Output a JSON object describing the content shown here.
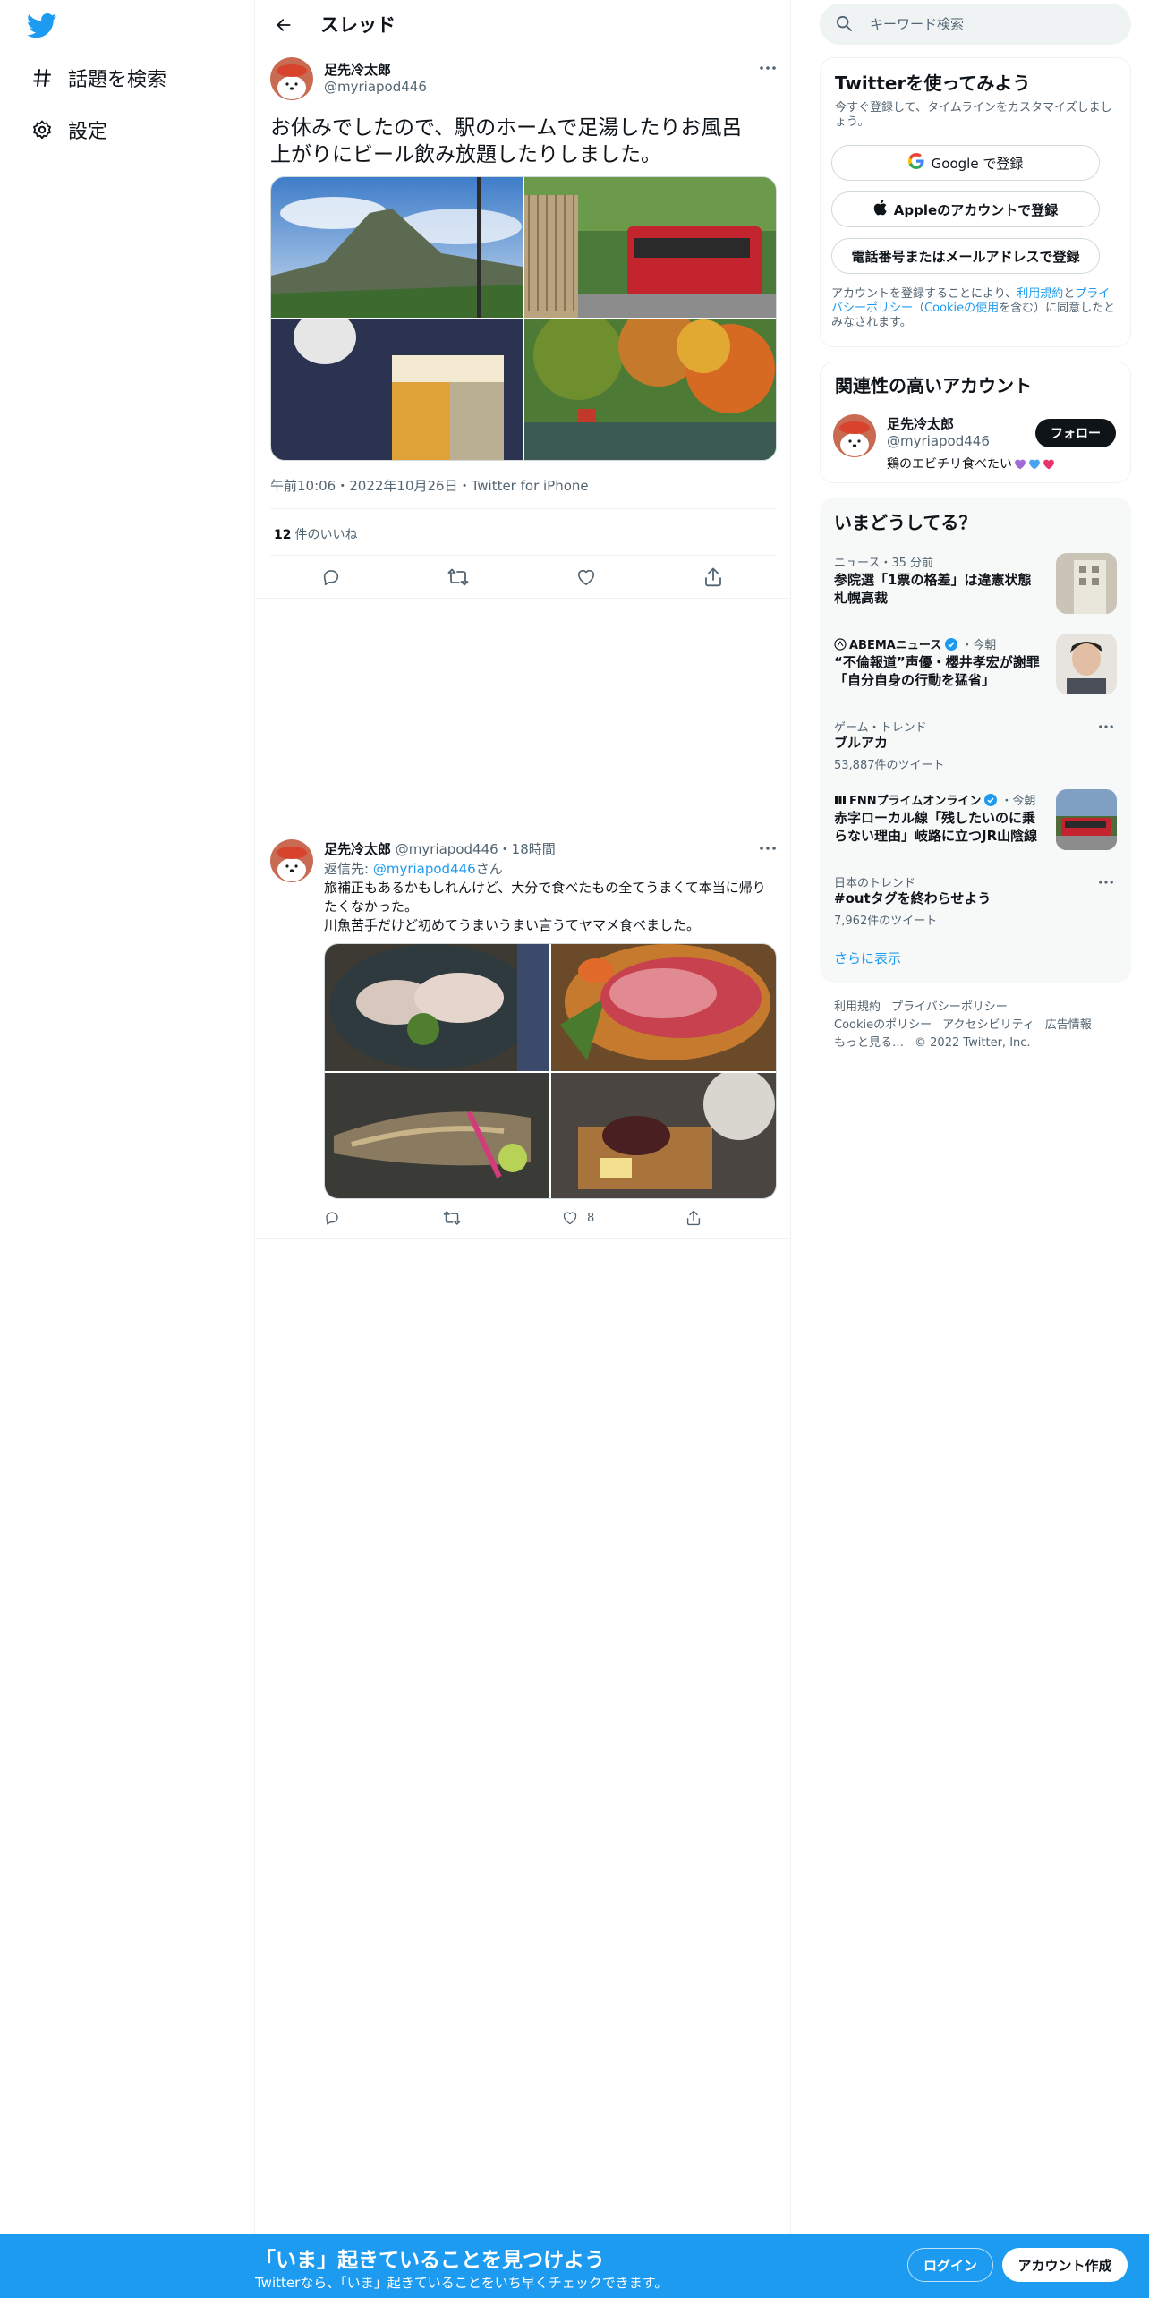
{
  "colors": {
    "accent": "#1d9bf0",
    "text": "#0f1419",
    "secondary": "#536471",
    "like_heart_purple": "#a36ad6",
    "like_heart_blue": "#4aa3f0",
    "like_heart_pink": "#e8336b"
  },
  "nav": {
    "logo_icon": "twitter-bird-icon",
    "items": [
      {
        "label": "話題を検索",
        "icon": "hashtag-icon"
      },
      {
        "label": "設定",
        "icon": "gear-icon"
      }
    ]
  },
  "header": {
    "title": "スレッド",
    "back_icon": "back-arrow-icon"
  },
  "main_tweet": {
    "author_name": "足先冷太郎",
    "author_handle": "@myriapod446",
    "text_line1": "お休みでしたので、駅のホームで足湯したりお風呂",
    "text_line2": "上がりにビール飲み放題したりしました。",
    "images": [
      "mountain-photo",
      "red-train-photo",
      "beer-glass-photo",
      "autumn-pond-photo"
    ],
    "timestamp": "午前10:06・2022年10月26日・Twitter for iPhone",
    "likes_count": "12",
    "likes_label": "件のいいね"
  },
  "reply_tweet": {
    "author_name": "足先冷太郎",
    "author_handle": "@myriapod446",
    "time": "・18時間",
    "reply_prefix": "返信先: ",
    "reply_mention": "@myriapod446",
    "reply_suffix": "さん",
    "text_line1": "旅補正もあるかもしれんけど、大分で食べたもの全てうまくて本当に帰り",
    "text_line2": "たくなかった。",
    "text_line3": "川魚苦手だけど初めてうまいうまい言うてヤマメ食べました。",
    "images": [
      "sashimi-photo",
      "raw-beef-photo",
      "grilled-fish-photo",
      "toast-dessert-photo"
    ],
    "like_count": "8"
  },
  "search": {
    "placeholder": "キーワード検索"
  },
  "signup_card": {
    "title": "Twitterを使ってみよう",
    "subtitle": "今すぐ登録して、タイムラインをカスタマイズしましょう。",
    "google_label": "Google で登録",
    "apple_label": "Appleのアカウントで登録",
    "phone_label": "電話番号またはメールアドレスで登録",
    "legal_prefix": "アカウントを登録することにより、",
    "legal_terms": "利用規約",
    "legal_and": "と",
    "legal_privacy": "プライバシーポリシー",
    "legal_open": "（",
    "legal_cookie": "Cookieの使用",
    "legal_suffix": "を含む）に同意したとみなされます。"
  },
  "related_card": {
    "title": "関連性の高いアカウント",
    "name": "足先冷太郎",
    "handle": "@myriapod446",
    "follow_label": "フォロー",
    "bio": "鶏のエビチリ食べたい"
  },
  "trends_card": {
    "title": "いまどうしてる？",
    "items": [
      {
        "meta": "ニュース・35 分前",
        "title_line1": "参院選「1票の格差」は違憲状態",
        "title_line2": "札幌高裁",
        "count": ""
      },
      {
        "meta_source": "ABEMAニュース",
        "meta_time": "・今朝",
        "title_line1": "“不倫報道”声優・櫻井孝宏が謝罪",
        "title_line2": "「自分自身の行動を猛省」",
        "count": ""
      },
      {
        "meta": "ゲーム・トレンド",
        "title_line1": "ブルアカ",
        "title_line2": "",
        "count": "53,887件のツイート"
      },
      {
        "meta_source": "FNNプライムオンライン",
        "meta_time": "・今朝",
        "title_line1": "赤字ローカル線「残したいのに乗",
        "title_line2": "らない理由」岐路に立つJR山陰線",
        "count": ""
      },
      {
        "meta": "日本のトレンド",
        "title_line1": "#outタグを終わらせよう",
        "title_line2": "",
        "count": "7,962件のツイート"
      }
    ],
    "show_more": "さらに表示"
  },
  "footer": {
    "links_row1": [
      "利用規約",
      "プライバシーポリシー"
    ],
    "links_row2": [
      "Cookieのポリシー",
      "アクセシビリティ",
      "広告情報"
    ],
    "more": "もっと見る…",
    "copyright": "© 2022 Twitter, Inc."
  },
  "bottom_bar": {
    "title": "「いま」起きていることを見つけよう",
    "subtitle": "Twitterなら、「いま」起きていることをいち早くチェックできます。",
    "login_label": "ログイン",
    "signup_label": "アカウント作成"
  }
}
